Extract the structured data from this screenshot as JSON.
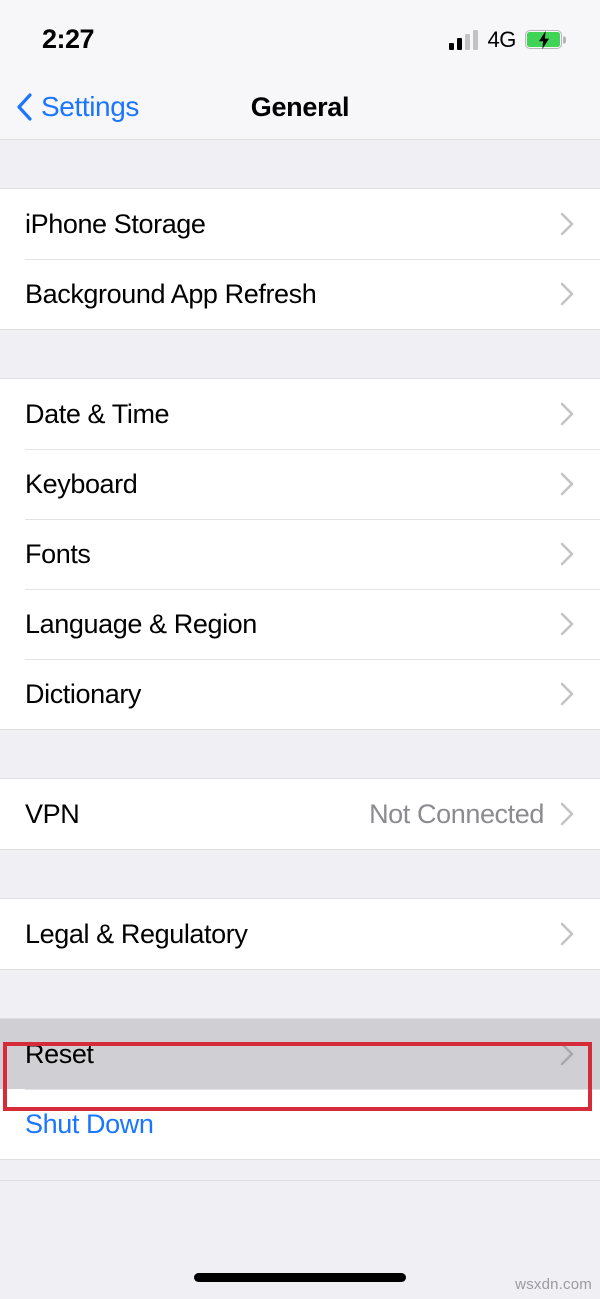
{
  "status_bar": {
    "time": "2:27",
    "network_label": "4G",
    "signal_bars_filled": 2,
    "signal_bars_total": 4,
    "battery_charging": true,
    "battery_color": "#3fd455"
  },
  "nav": {
    "back_label": "Settings",
    "title": "General",
    "tint_color": "#1a76ff"
  },
  "sections": [
    {
      "rows": [
        {
          "label": "iPhone Storage",
          "value": "",
          "chevron": true,
          "style": "default"
        },
        {
          "label": "Background App Refresh",
          "value": "",
          "chevron": true,
          "style": "default"
        }
      ]
    },
    {
      "rows": [
        {
          "label": "Date & Time",
          "value": "",
          "chevron": true,
          "style": "default"
        },
        {
          "label": "Keyboard",
          "value": "",
          "chevron": true,
          "style": "default"
        },
        {
          "label": "Fonts",
          "value": "",
          "chevron": true,
          "style": "default"
        },
        {
          "label": "Language & Region",
          "value": "",
          "chevron": true,
          "style": "default"
        },
        {
          "label": "Dictionary",
          "value": "",
          "chevron": true,
          "style": "default"
        }
      ]
    },
    {
      "rows": [
        {
          "label": "VPN",
          "value": "Not Connected",
          "chevron": true,
          "style": "default"
        }
      ]
    },
    {
      "rows": [
        {
          "label": "Legal & Regulatory",
          "value": "",
          "chevron": true,
          "style": "default"
        }
      ]
    },
    {
      "rows": [
        {
          "label": "Reset",
          "value": "",
          "chevron": true,
          "style": "highlighted"
        },
        {
          "label": "Shut Down",
          "value": "",
          "chevron": false,
          "style": "link"
        }
      ]
    }
  ],
  "annotation": {
    "target_label": "Reset",
    "border_color": "#d62b38"
  },
  "footer": {
    "watermark": "wsxdn.com"
  },
  "colors": {
    "group_background": "#ffffff",
    "page_background": "#f0f0f4",
    "separator": "#e3e3e5",
    "secondary_text": "#8b8b90",
    "chevron": "#c4c4c6",
    "highlight_row_background": "#d0d0d4"
  }
}
